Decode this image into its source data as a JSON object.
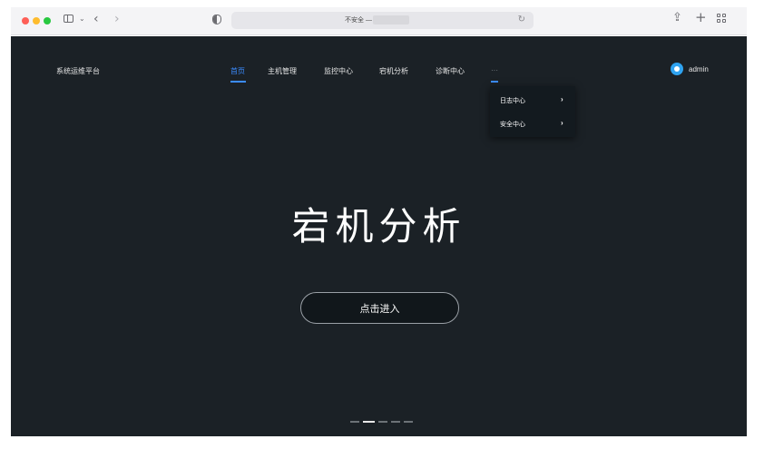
{
  "browser": {
    "address_text": "不安全 —",
    "icons": [
      "sidebar-toggle-icon",
      "chevron-down-icon",
      "back-arrow-icon",
      "forward-arrow-icon",
      "privacy-shield-icon",
      "reload-icon",
      "share-icon",
      "new-tab-plus-icon",
      "tab-overview-grid-icon"
    ]
  },
  "app": {
    "brand": "系统运维平台",
    "nav": [
      {
        "label": "首页",
        "active": true
      },
      {
        "label": "主机管理",
        "active": false
      },
      {
        "label": "监控中心",
        "active": false
      },
      {
        "label": "宕机分析",
        "active": false
      },
      {
        "label": "诊断中心",
        "active": false
      },
      {
        "label": "···",
        "active": false
      }
    ],
    "user": {
      "name": "admin"
    },
    "dropdown": [
      {
        "label": "日志中心",
        "arrow": "›"
      },
      {
        "label": "安全中心",
        "arrow": "›"
      }
    ],
    "hero": {
      "title": "宕机分析",
      "button_label": "点击进入"
    },
    "carousel": {
      "count": 5,
      "active_index": 1
    },
    "colors": {
      "background": "#1b2126",
      "accent": "#3b8cff",
      "text": "#e6e6e6"
    }
  }
}
